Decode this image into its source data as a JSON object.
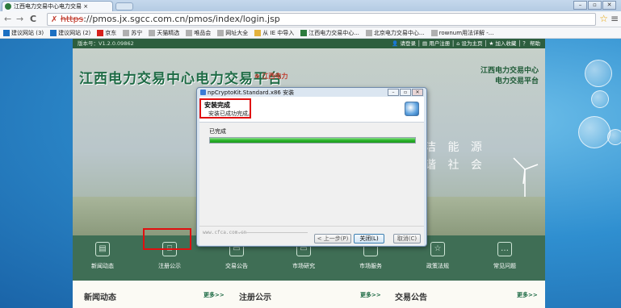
{
  "browser": {
    "tab_title": "江西电力交易中心电力交易 ×",
    "tab_close": "×",
    "window_buttons": [
      "–",
      "▫",
      "✕"
    ],
    "nav_back": "←",
    "nav_forward": "→",
    "nav_reload": "C",
    "url_lock": "✗",
    "url_scheme": "https",
    "url_rest": "://pmos.jx.sgcc.com.cn/pmos/index/login.jsp",
    "star": "☆",
    "menu": "≡",
    "bookmarks": [
      {
        "label": "建议网站 (3)",
        "color": "#1b6fc2"
      },
      {
        "label": "建议网站 (2)",
        "color": "#1b6fc2"
      },
      {
        "label": "京东",
        "color": "#d6211c"
      },
      {
        "label": "苏宁",
        "color": "#b0b0b0"
      },
      {
        "label": "天猫精选",
        "color": "#b0b0b0"
      },
      {
        "label": "唯品会",
        "color": "#b0b0b0"
      },
      {
        "label": "网址大全",
        "color": "#b0b0b0"
      },
      {
        "label": "从 IE 中导入",
        "color": "#e3b23c"
      },
      {
        "label": "江西电力交易中心...",
        "color": "#2d7b3d"
      },
      {
        "label": "北京电力交易中心...",
        "color": "#b0b0b0"
      },
      {
        "label": "rownum用法详解 -...",
        "color": "#b0b0b0"
      }
    ]
  },
  "site": {
    "version": "版本号：V1.2.0.09862",
    "topnav": "👤 请登录 │ ▤ 用户注册 │ ⌂ 设为主页 │ ★ 加入收藏 │ ？ 帮助",
    "title": "江西电力交易中心电力交易平台",
    "subtitle": "⊕ 江西电力",
    "right_title_1": "江西电力交易中心",
    "right_title_2": "电力交易平台",
    "slogan_1": "洁 能 源",
    "slogan_2": "谐 社 会",
    "icons": [
      {
        "label": "新闻动态",
        "glyph": "▤"
      },
      {
        "label": "注册公示",
        "glyph": "⌸"
      },
      {
        "label": "交易公告",
        "glyph": "▭"
      },
      {
        "label": "市场研究",
        "glyph": "▭"
      },
      {
        "label": "市场服务",
        "glyph": "⌒"
      },
      {
        "label": "政策法规",
        "glyph": "☆"
      },
      {
        "label": "常见问题",
        "glyph": "…"
      }
    ],
    "news": [
      {
        "title": "新闻动态",
        "more": "更多>>"
      },
      {
        "title": "注册公示",
        "more": "更多>>"
      },
      {
        "title": "交易公告",
        "more": "更多>>"
      }
    ]
  },
  "dialog": {
    "title": "npCryptoKit.Standard.x86 安装",
    "btn_min": "–",
    "btn_max": "▫",
    "btn_close": "✕",
    "header_title": "安装完成",
    "header_sub": "安装已成功完成。",
    "done_label": "已完成",
    "progress": 1.0,
    "brand": "www.cfca.com.cn",
    "back_button": "< 上一步(P)",
    "close_button": "关闭(L)",
    "cancel_button": "取消(C)"
  }
}
